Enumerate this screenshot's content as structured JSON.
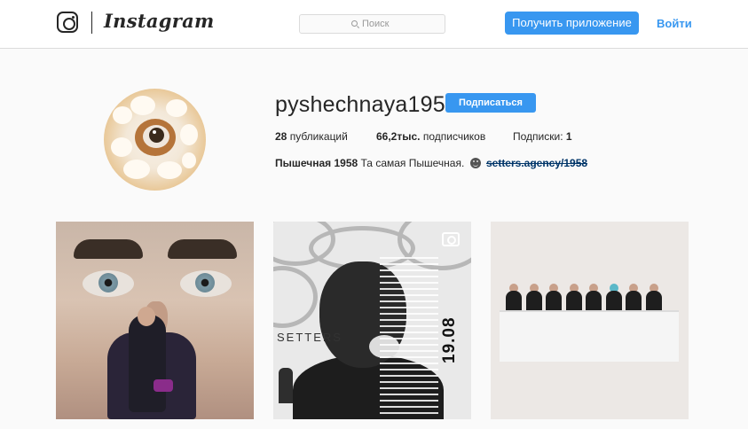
{
  "header": {
    "brand": "Instagram",
    "search_placeholder": "Поиск",
    "get_app_label": "Получить приложение",
    "login_label": "Войти"
  },
  "profile": {
    "username": "pyshechnaya1958",
    "follow_label": "Подписаться",
    "stats": {
      "posts_count": "28",
      "posts_label": "публикаций",
      "followers_count": "66,2тыс.",
      "followers_label": "подписчиков",
      "following_label": "Подписки:",
      "following_count": "1"
    },
    "bio": {
      "name": "Пышечная 1958",
      "text": "Та самая Пышечная.",
      "link": "setters.agency/1958"
    }
  },
  "posts": [
    {
      "icon": "image"
    },
    {
      "brand_text": "SETTERS",
      "date_text": "19.08",
      "icon": "camera-icon"
    },
    {
      "icon": "image"
    }
  ],
  "colors": {
    "accent": "#3897f0",
    "link": "#003569",
    "background": "#fafafa",
    "header_bg": "#ffffff",
    "border": "#dbdbdb"
  }
}
